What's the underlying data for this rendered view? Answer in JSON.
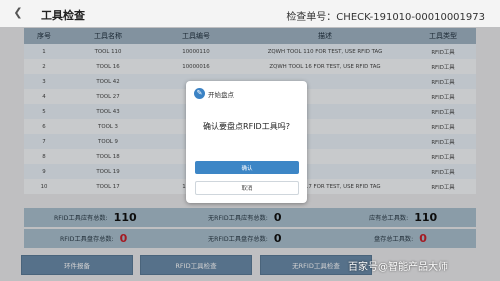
{
  "header": {
    "back_icon": "chevron-left-icon",
    "title": "工具检查",
    "check_no": "检查单号：CHECK-191010-00010001973"
  },
  "table": {
    "headers": [
      "序号",
      "工具名称",
      "工具编号",
      "描述",
      "工具类型"
    ],
    "rows": [
      {
        "no": "1",
        "name": "TOOL 110",
        "code": "10000110",
        "desc": "ZQWH TOOL 110 FOR TEST, USE RFID TAG",
        "type": "RFID工具"
      },
      {
        "no": "2",
        "name": "TOOL 16",
        "code": "10000016",
        "desc": "ZQWH TOOL 16 FOR TEST, USE RFID TAG",
        "type": "RFID工具"
      },
      {
        "no": "3",
        "name": "TOOL 42",
        "code": "",
        "desc": "",
        "type": "RFID工具"
      },
      {
        "no": "4",
        "name": "TOOL 27",
        "code": "",
        "desc": "",
        "type": "RFID工具"
      },
      {
        "no": "5",
        "name": "TOOL 43",
        "code": "",
        "desc": "",
        "type": "RFID工具"
      },
      {
        "no": "6",
        "name": "TOOL 3",
        "code": "",
        "desc": "",
        "type": "RFID工具"
      },
      {
        "no": "7",
        "name": "TOOL 9",
        "code": "",
        "desc": "",
        "type": "RFID工具"
      },
      {
        "no": "8",
        "name": "TOOL 18",
        "code": "",
        "desc": "",
        "type": "RFID工具"
      },
      {
        "no": "9",
        "name": "TOOL 19",
        "code": "",
        "desc": "",
        "type": "RFID工具"
      },
      {
        "no": "10",
        "name": "TOOL 17",
        "code": "10000017",
        "desc": "ZQWH TOOL 17 FOR TEST, USE RFID TAG",
        "type": "RFID工具"
      }
    ]
  },
  "summary": {
    "rfid_should": {
      "label": "RFID工具应有总数:",
      "value": "110"
    },
    "norfid_should": {
      "label": "无RFID工具应有总数:",
      "value": "0"
    },
    "should_total": {
      "label": "应有总工具数:",
      "value": "110"
    },
    "rfid_stock": {
      "label": "RFID工具盘存总数:",
      "value": "0"
    },
    "norfid_stock": {
      "label": "无RFID工具盘存总数:",
      "value": "0"
    },
    "stock_total": {
      "label": "盘存总工具数:",
      "value": "0"
    }
  },
  "buttons": {
    "report": "环件报备",
    "rfid_check": "RFID工具检查",
    "norfid_check": "无RFID工具检查"
  },
  "dialog": {
    "icon": "pen-icon",
    "title": "开始盘点",
    "message": "确认要盘点RFID工具吗?",
    "ok": "确认",
    "cancel": "取消"
  },
  "watermark": "百家号@智能产品大师"
}
